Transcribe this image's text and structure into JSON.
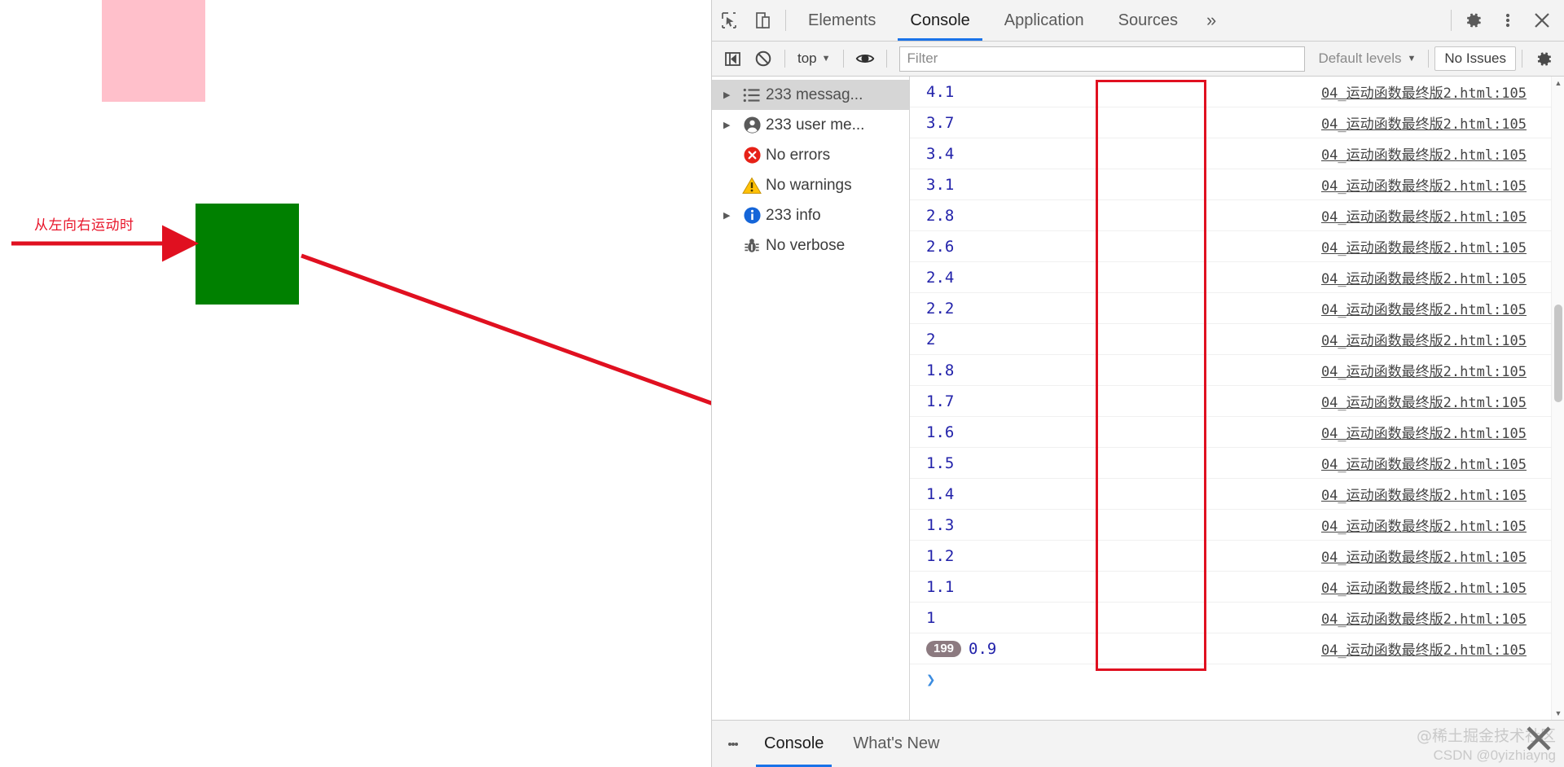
{
  "page": {
    "annotation_label": "从左向右运动时",
    "pink_box_color": "#ffc0cb",
    "green_box_color": "#008000",
    "arrow_color": "#e01020"
  },
  "devtools": {
    "tabs": [
      {
        "label": "Elements",
        "active": false
      },
      {
        "label": "Console",
        "active": true
      },
      {
        "label": "Application",
        "active": false
      },
      {
        "label": "Sources",
        "active": false
      }
    ],
    "more_tabs_glyph": "»",
    "icons": {
      "inspect": "inspect-element-icon",
      "device": "device-toolbar-icon",
      "settings": "gear-icon",
      "kebab": "more-options-icon",
      "close": "close-icon"
    },
    "console_toolbar": {
      "sidebar_toggle": "console-sidebar-toggle-icon",
      "clear": "clear-console-icon",
      "context": "top",
      "context_caret": "▼",
      "live_expression": "eye-icon",
      "filter_placeholder": "Filter",
      "filter_value": "",
      "levels_label": "Default levels",
      "levels_caret": "▼",
      "issues_label": "No Issues",
      "settings": "gear-icon"
    },
    "sidebar": [
      {
        "label": "233 messag...",
        "icon": "list-icon",
        "expandable": true,
        "selected": true
      },
      {
        "label": "233 user me...",
        "icon": "user-icon",
        "expandable": true,
        "selected": false
      },
      {
        "label": "No errors",
        "icon": "error-icon",
        "expandable": false,
        "selected": false
      },
      {
        "label": "No warnings",
        "icon": "warning-icon",
        "expandable": false,
        "selected": false
      },
      {
        "label": "233 info",
        "icon": "info-icon",
        "expandable": true,
        "selected": false
      },
      {
        "label": "No verbose",
        "icon": "bug-icon",
        "expandable": false,
        "selected": false
      }
    ],
    "log_source": "04_运动函数最终版2.html:105",
    "log_rows": [
      {
        "value": "4.1",
        "count": null
      },
      {
        "value": "3.7",
        "count": null
      },
      {
        "value": "3.4",
        "count": null
      },
      {
        "value": "3.1",
        "count": null
      },
      {
        "value": "2.8",
        "count": null
      },
      {
        "value": "2.6",
        "count": null
      },
      {
        "value": "2.4",
        "count": null
      },
      {
        "value": "2.2",
        "count": null
      },
      {
        "value": "2",
        "count": null
      },
      {
        "value": "1.8",
        "count": null
      },
      {
        "value": "1.7",
        "count": null
      },
      {
        "value": "1.6",
        "count": null
      },
      {
        "value": "1.5",
        "count": null
      },
      {
        "value": "1.4",
        "count": null
      },
      {
        "value": "1.3",
        "count": null
      },
      {
        "value": "1.2",
        "count": null
      },
      {
        "value": "1.1",
        "count": null
      },
      {
        "value": "1",
        "count": null
      },
      {
        "value": "0.9",
        "count": "199"
      }
    ],
    "prompt_caret": "❯",
    "drawer": {
      "tabs": [
        {
          "label": "Console",
          "active": true
        },
        {
          "label": "What's New",
          "active": false
        }
      ]
    }
  },
  "watermark": {
    "line1": "@稀土掘金技术社区",
    "line2": "CSDN @0yizhiayng"
  }
}
